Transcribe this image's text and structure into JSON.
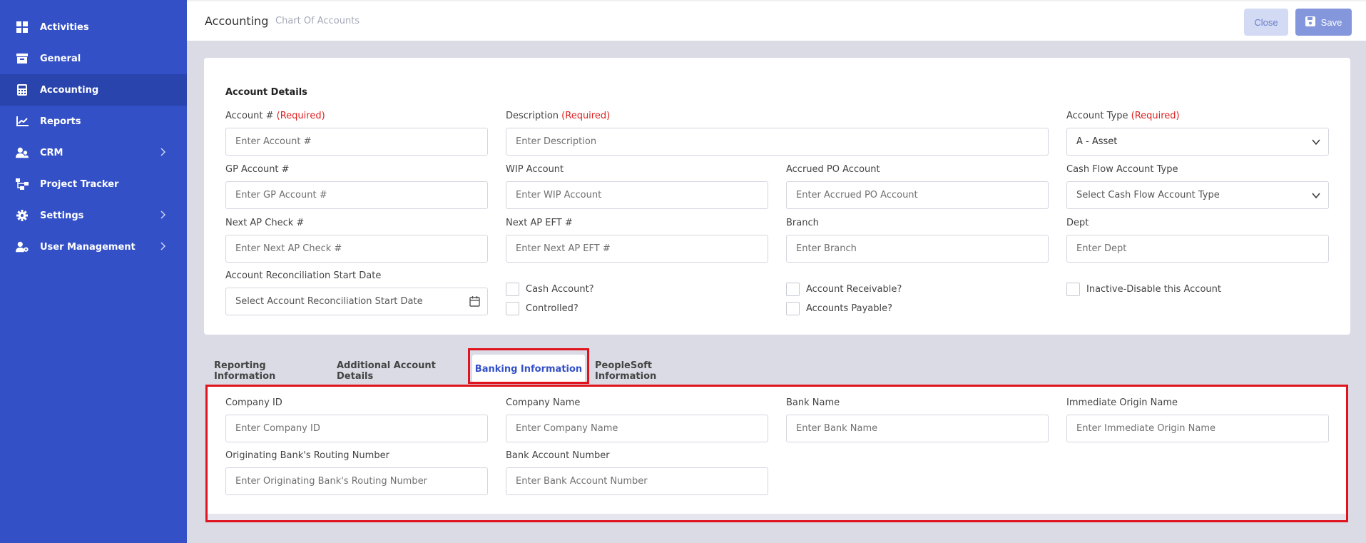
{
  "sidebar": {
    "items": [
      {
        "label": "Activities",
        "icon": "grid-icon"
      },
      {
        "label": "General",
        "icon": "archive-icon"
      },
      {
        "label": "Accounting",
        "icon": "calculator-icon",
        "active": true
      },
      {
        "label": "Reports",
        "icon": "chart-line-icon"
      },
      {
        "label": "CRM",
        "icon": "users-icon",
        "chevron": true
      },
      {
        "label": "Project Tracker",
        "icon": "sitemap-icon"
      },
      {
        "label": "Settings",
        "icon": "gear-icon",
        "chevron": true
      },
      {
        "label": "User Management",
        "icon": "user-cog-icon",
        "chevron": true
      }
    ]
  },
  "header": {
    "title": "Accounting",
    "breadcrumb": "Chart Of Accounts",
    "close_label": "Close",
    "save_label": "Save"
  },
  "account_details": {
    "section_title": "Account Details",
    "required_text": "(Required)",
    "account_no": {
      "label": "Account # ",
      "placeholder": "Enter Account #"
    },
    "description": {
      "label": "Description ",
      "placeholder": "Enter Description"
    },
    "account_type": {
      "label": "Account Type ",
      "value": "A - Asset"
    },
    "gp_account": {
      "label": "GP Account #",
      "placeholder": "Enter GP Account #"
    },
    "wip_account": {
      "label": "WIP Account",
      "placeholder": "Enter WIP Account"
    },
    "accrued_po": {
      "label": "Accrued PO Account",
      "placeholder": "Enter Accrued PO Account"
    },
    "cash_flow_type": {
      "label": "Cash Flow Account Type",
      "value": "Select Cash Flow Account Type"
    },
    "next_ap_check": {
      "label": "Next AP Check #",
      "placeholder": "Enter Next AP Check #"
    },
    "next_ap_eft": {
      "label": "Next AP EFT #",
      "placeholder": "Enter Next AP EFT #"
    },
    "branch": {
      "label": "Branch",
      "placeholder": "Enter Branch"
    },
    "dept": {
      "label": "Dept",
      "placeholder": "Enter Dept"
    },
    "recon_date": {
      "label": "Account Reconciliation Start Date",
      "placeholder": "Select Account Reconciliation Start Date"
    },
    "checks": {
      "cash_account": "Cash Account?",
      "controlled": "Controlled?",
      "account_receivable": "Account Receivable?",
      "accounts_payable": "Accounts Payable?",
      "inactive": "Inactive-Disable this Account"
    }
  },
  "tabs": [
    {
      "label": "Reporting Information"
    },
    {
      "label": "Additional Account Details"
    },
    {
      "label": "Banking Information",
      "active": true
    },
    {
      "label": "PeopleSoft Information"
    }
  ],
  "banking": {
    "company_id": {
      "label": "Company ID",
      "placeholder": "Enter Company ID"
    },
    "company_name": {
      "label": "Company Name",
      "placeholder": "Enter Company Name"
    },
    "bank_name": {
      "label": "Bank Name",
      "placeholder": "Enter Bank Name"
    },
    "immediate_origin": {
      "label": "Immediate Origin Name",
      "placeholder": "Enter Immediate Origin Name"
    },
    "routing_number": {
      "label": "Originating Bank's Routing Number",
      "placeholder": "Enter Originating Bank's Routing Number"
    },
    "bank_account_number": {
      "label": "Bank Account Number",
      "placeholder": "Enter Bank Account Number"
    }
  },
  "colors": {
    "sidebar": "#3350c7",
    "sidebar_active": "#2a44ad",
    "required": "#e02020",
    "highlight": "#e0141e",
    "accent": "#3350c7"
  }
}
